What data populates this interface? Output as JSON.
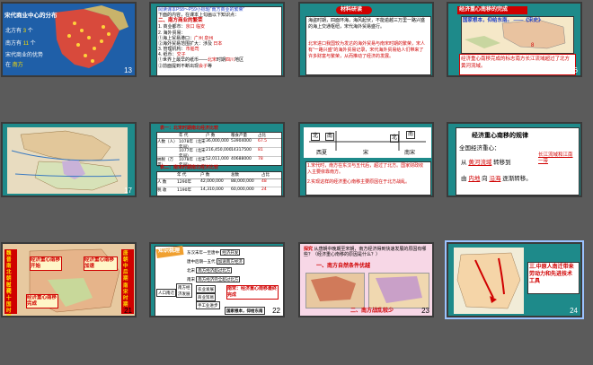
{
  "slides": [
    {
      "num": "13",
      "title": "宋代商业中心的分布",
      "lines": [
        "北方有",
        "南方有",
        "宋代商业的优势",
        "在"
      ],
      "nums": [
        "3",
        "11"
      ],
      "suffix": "个",
      "answer": "南方"
    },
    {
      "num": "14",
      "l1": "阅读课本P58～P59小标题“南方商业的繁荣”",
      "l2": "下面的内容，在课本上勾画以下知识点：",
      "l3": "二、南方商业的繁荣",
      "l4": "1. 商业都市：",
      "a1": "京口",
      "a2": "临安",
      "l4b": "是南宋最著名的商业都市",
      "l5": "2. 海外贸易：",
      "l6a": "①海上贸易港口：",
      "a3": "广州",
      "a4": "泉州",
      "l6b": "是宋代最大的海港。",
      "l7": "②海外贸易范围扩大：涉及",
      "a5": "日本",
      "l8": "3. 管理机构：",
      "a6": "市舶司",
      "l9": "4. 纸币：",
      "a7": "交子",
      "l10a": "①世界上最早的纸币——",
      "a8": "北宋",
      "l10b": "时期",
      "a9": "四川",
      "l10c": "地区",
      "l11a": "②前面提到不断出现",
      "a10": "会子",
      "l11b": "等"
    },
    {
      "num": "15",
      "badge": "材料研读",
      "p1": "海盗时期，四面环海，海风起伏，不能逾越三万里一路兴盛的海上交通枢纽，宋代海外贸易盛行。",
      "p2": "北宋进口我国较为发达的海外贸易与南宋时期的繁荣，宋人有“一路兴盛”的海外贸易记录，宋代海外贸易给人们带来了许多财富与繁荣，从而推动了经济的发展。"
    },
    {
      "num": "16",
      "banner": "经济重心南移的完成",
      "quote": "国家根本，仰给东南。 ——《宋史》",
      "ans": "8",
      "foot": "经济重心南移完成的标志南方长江流域超过了北方黄河流域。",
      "map": "北宋疆域图"
    },
    {
      "num": "17"
    },
    {
      "num": "18",
      "title1": "表一：北宋时期南北经济比较",
      "cols1": [
        "年 代",
        "户 数",
        "粮食产量",
        "占比"
      ],
      "rows1": [
        [
          "人数（人）",
          "1078年（北宋年间）",
          "36,000,000",
          "53904000",
          "67.5"
        ],
        [
          "",
          "1077年（北宋年间）",
          "216,450,000",
          "14317500",
          "81"
        ],
        [
          "纳税（万贯）",
          "1078年（北宋年间）",
          "52,011,000",
          "40688000",
          "78"
        ]
      ],
      "title2": "表二：南宋时期南北经济比较",
      "cols2": [
        "",
        "年 代",
        "户 数",
        "总数",
        "占比"
      ],
      "rows2": [
        [
          "人 数",
          "1290年",
          "42,000,000",
          "88,000,000",
          "48"
        ],
        [
          "税 收",
          "1190年",
          "14,310,000",
          "60,000,000",
          "24"
        ]
      ]
    },
    {
      "num": "19",
      "labels": [
        "北",
        "南",
        "北",
        "南"
      ],
      "towns": [
        "西夏",
        "宋",
        "南宋"
      ],
      "q1": "1.宋代时，南方在东汉与五代后，超过了北方。国家财政收入主要依靠南方。",
      "q2": "2.实现这样的经济重心南移主要原因在于北方战乱。"
    },
    {
      "num": "20",
      "title": "经济重心南移的规律",
      "l2": "全国经济重心：",
      "l3a": "从",
      "a1": "黄河流域",
      "l3b": "转移到",
      "a2": "长江流域和江南一带",
      "l4a": "由",
      "a3": "内地",
      "l4b": "向",
      "a4": "沿海",
      "l4c": "逐渐转移。"
    },
    {
      "num": "21",
      "left": [
        "魏晋南北朝时期",
        "五代十国时期"
      ],
      "right": [
        "唐朝中后期",
        "南宋时期"
      ],
      "mid": [
        "经济重心南移开始",
        "经济重心南移完成",
        "经济重心南移加速"
      ]
    },
    {
      "num": "22",
      "badge": "知识梳理",
      "row1": "东汉末年一至唐中",
      "row1b": "经济开发",
      "row2": "唐中后期一五代",
      "row2b": "加速南方经济",
      "row3": "北宋",
      "row3b": "南方经济超过北方",
      "row4": "南宋",
      "row4b": "南方经济完全超过北方",
      "left": "人口南迁",
      "mid": "南方经济发展",
      "bot": "南宋：经济重心南移最终完成",
      "b1": "农业发展",
      "b2": "商业贸易",
      "b3": "手工业进步",
      "base": "国家根本，仰给东南"
    },
    {
      "num": "23",
      "badge": "探究",
      "q": "从唐朝中晚期至宋朝，南方经济得到快速发展的原因有哪些？（经济重心南移的原因是什么？）",
      "a1": "一、南方自然条件优越",
      "a2": "二、南方战乱较少"
    },
    {
      "num": "24",
      "q": "三.中原人南迁带来劳动力和先进技术工具"
    }
  ],
  "colors": {
    "accent": "#d00000",
    "answer_blue": "#1a3cc8",
    "teal": "#1e8a8a",
    "pink": "#f7d7e6"
  }
}
